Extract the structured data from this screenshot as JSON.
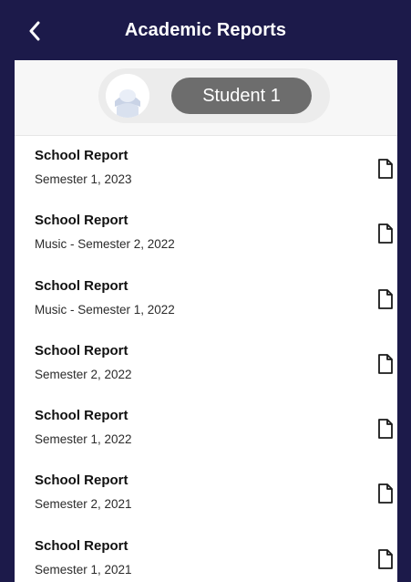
{
  "header": {
    "title": "Academic Reports",
    "back_icon": "chevron-left-icon"
  },
  "student": {
    "name": "Student 1",
    "avatar_icon": "user-avatar-icon"
  },
  "reports": [
    {
      "title": "School Report",
      "subtitle": "Semester 1, 2023"
    },
    {
      "title": "School Report",
      "subtitle": "Music - Semester 2, 2022"
    },
    {
      "title": "School Report",
      "subtitle": "Music - Semester 1, 2022"
    },
    {
      "title": "School Report",
      "subtitle": "Semester 2, 2022"
    },
    {
      "title": "School Report",
      "subtitle": "Semester 1, 2022"
    },
    {
      "title": "School Report",
      "subtitle": "Semester 2, 2021"
    },
    {
      "title": "School Report",
      "subtitle": "Semester 1, 2021"
    }
  ],
  "colors": {
    "header_bg": "#1c1a4a",
    "name_pill_bg": "#6d6d6d",
    "text_primary": "#111111"
  },
  "icons": {
    "report_icon": "document-icon"
  }
}
